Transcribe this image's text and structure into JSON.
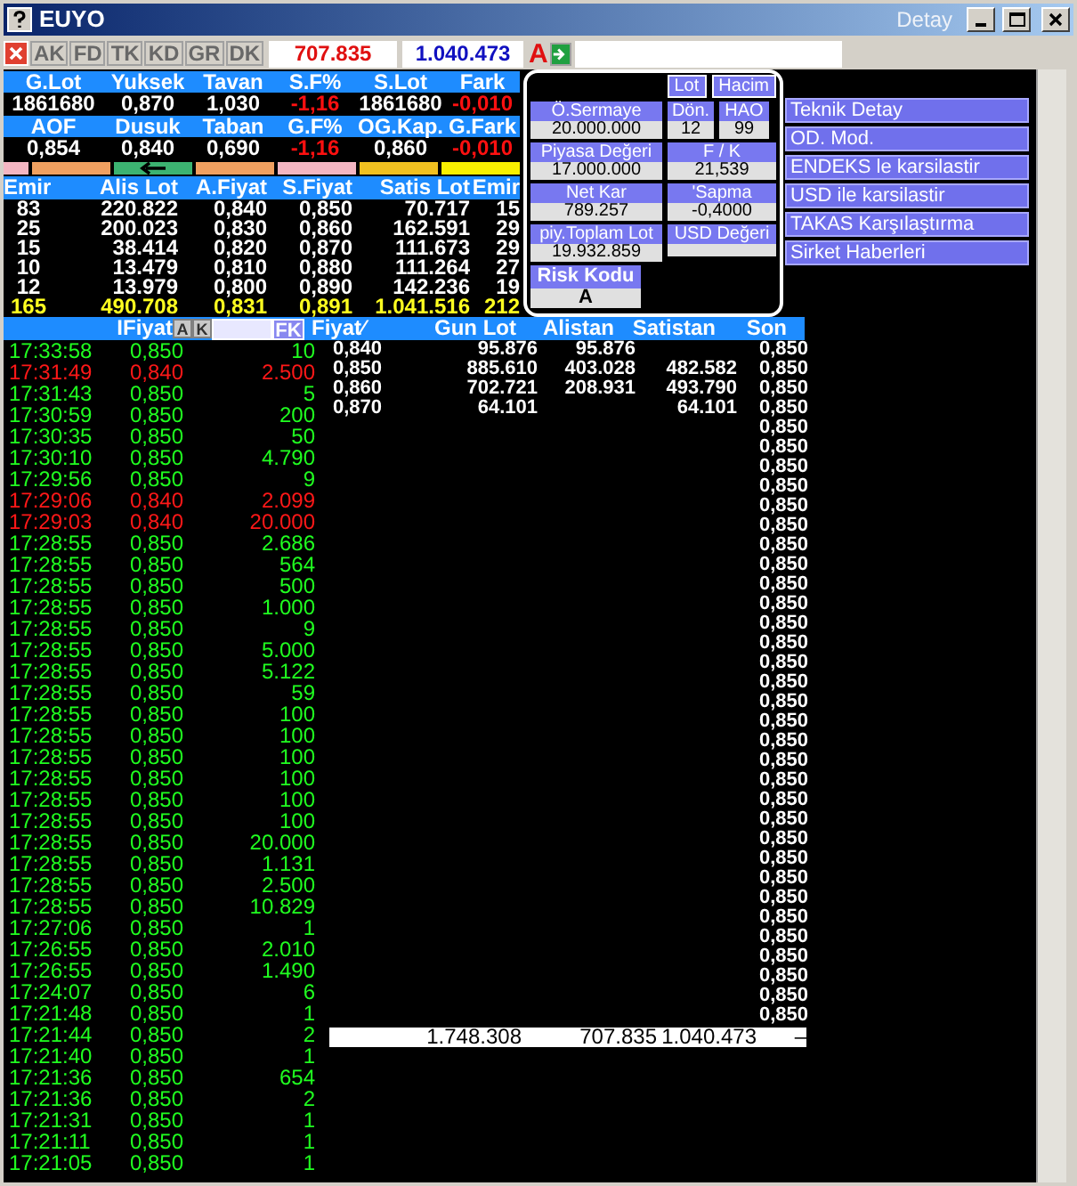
{
  "window": {
    "title": "EUYO",
    "detail_label": "Detay"
  },
  "toolbar": {
    "tabs": [
      "AK",
      "FD",
      "TK",
      "KD",
      "GR",
      "DK"
    ],
    "value_1": "707.835",
    "value_2": "1.040.473",
    "flag": "A"
  },
  "summary": [
    {
      "headers": [
        "G.Lot",
        "Yuksek",
        "Tavan",
        "S.F%",
        "S.Lot",
        "Fark"
      ],
      "values": [
        {
          "text": "1861680",
          "negative": false
        },
        {
          "text": "0,870",
          "negative": false
        },
        {
          "text": "1,030",
          "negative": false
        },
        {
          "text": "-1,16",
          "negative": true
        },
        {
          "text": "1861680",
          "negative": false
        },
        {
          "text": "-0,010",
          "negative": true
        }
      ]
    },
    {
      "headers": [
        "AOF",
        "Dusuk",
        "Taban",
        "G.F%",
        "OG.Kap.",
        "G.Fark"
      ],
      "values": [
        {
          "text": "0,854",
          "negative": false
        },
        {
          "text": "0,840",
          "negative": false
        },
        {
          "text": "0,690",
          "negative": false
        },
        {
          "text": "-1,16",
          "negative": true
        },
        {
          "text": "0,860",
          "negative": false
        },
        {
          "text": "-0,010",
          "negative": true
        }
      ]
    }
  ],
  "color_strip": [
    {
      "color": "#f4b6c2",
      "arrow": false
    },
    {
      "color": "#f0a060",
      "arrow": false
    },
    {
      "color": "#3cb371",
      "arrow": true
    },
    {
      "color": "#f0a060",
      "arrow": false
    },
    {
      "color": "#f4b6c2",
      "arrow": false
    },
    {
      "color": "#f0c020",
      "arrow": false
    },
    {
      "color": "#f8f000",
      "arrow": false
    }
  ],
  "order_book": {
    "columns": [
      "Emir",
      "Alis Lot",
      "A.Fiyat",
      "S.Fiyat",
      "Satis Lot",
      "Emir"
    ],
    "rows": [
      [
        "83",
        "220.822",
        "0,840",
        "0,850",
        "70.717",
        "15"
      ],
      [
        "25",
        "200.023",
        "0,830",
        "0,860",
        "162.591",
        "29"
      ],
      [
        "15",
        "38.414",
        "0,820",
        "0,870",
        "111.673",
        "29"
      ],
      [
        "10",
        "13.479",
        "0,810",
        "0,880",
        "111.264",
        "27"
      ],
      [
        "12",
        "13.979",
        "0,800",
        "0,890",
        "142.236",
        "19"
      ]
    ],
    "total": [
      "165",
      "490.708",
      "0,831",
      "0,891",
      "1.041.516",
      "212"
    ]
  },
  "info_panel": {
    "tabs": [
      "Lot",
      "Hacim"
    ],
    "field_rows": [
      [
        {
          "label": "Ö.Sermaye",
          "value": "20.000.000"
        },
        {
          "label": "Dön.",
          "value": "12"
        },
        {
          "label": "HAO",
          "value": "99"
        }
      ],
      [
        {
          "label": "Piyasa Değeri",
          "value": "17.000.000"
        },
        {
          "label": "F / K",
          "value": "21,539"
        }
      ],
      [
        {
          "label": "Net Kar",
          "value": "789.257"
        },
        {
          "label": "'Sapma",
          "value": "-0,4000"
        }
      ],
      [
        {
          "label": "piy.Toplam Lot",
          "value": "19.932.859"
        },
        {
          "label": "USD Değeri"
        }
      ]
    ],
    "risk": {
      "label": "Risk Kodu",
      "value": "A"
    }
  },
  "actions": [
    "Teknik Detay",
    "OD. Mod.",
    "ENDEKS le karsilastir",
    "USD ile karsilastir",
    "TAKAS Karşılaştırma",
    "Sirket Haberleri"
  ],
  "trades": {
    "column": "IFiyat",
    "filters": [
      "A",
      "K"
    ],
    "fk": "FK",
    "rows": [
      {
        "time": "17:33:58",
        "price": "0,850",
        "lot": "10",
        "falling": false
      },
      {
        "time": "17:31:49",
        "price": "0,840",
        "lot": "2.500",
        "falling": true
      },
      {
        "time": "17:31:43",
        "price": "0,850",
        "lot": "5",
        "falling": false
      },
      {
        "time": "17:30:59",
        "price": "0,850",
        "lot": "200",
        "falling": false
      },
      {
        "time": "17:30:35",
        "price": "0,850",
        "lot": "50",
        "falling": false
      },
      {
        "time": "17:30:10",
        "price": "0,850",
        "lot": "4.790",
        "falling": false
      },
      {
        "time": "17:29:56",
        "price": "0,850",
        "lot": "9",
        "falling": false
      },
      {
        "time": "17:29:06",
        "price": "0,840",
        "lot": "2.099",
        "falling": true
      },
      {
        "time": "17:29:03",
        "price": "0,840",
        "lot": "20.000",
        "falling": true
      },
      {
        "time": "17:28:55",
        "price": "0,850",
        "lot": "2.686",
        "falling": false
      },
      {
        "time": "17:28:55",
        "price": "0,850",
        "lot": "564",
        "falling": false
      },
      {
        "time": "17:28:55",
        "price": "0,850",
        "lot": "500",
        "falling": false
      },
      {
        "time": "17:28:55",
        "price": "0,850",
        "lot": "1.000",
        "falling": false
      },
      {
        "time": "17:28:55",
        "price": "0,850",
        "lot": "9",
        "falling": false
      },
      {
        "time": "17:28:55",
        "price": "0,850",
        "lot": "5.000",
        "falling": false
      },
      {
        "time": "17:28:55",
        "price": "0,850",
        "lot": "5.122",
        "falling": false
      },
      {
        "time": "17:28:55",
        "price": "0,850",
        "lot": "59",
        "falling": false
      },
      {
        "time": "17:28:55",
        "price": "0,850",
        "lot": "100",
        "falling": false
      },
      {
        "time": "17:28:55",
        "price": "0,850",
        "lot": "100",
        "falling": false
      },
      {
        "time": "17:28:55",
        "price": "0,850",
        "lot": "100",
        "falling": false
      },
      {
        "time": "17:28:55",
        "price": "0,850",
        "lot": "100",
        "falling": false
      },
      {
        "time": "17:28:55",
        "price": "0,850",
        "lot": "100",
        "falling": false
      },
      {
        "time": "17:28:55",
        "price": "0,850",
        "lot": "100",
        "falling": false
      },
      {
        "time": "17:28:55",
        "price": "0,850",
        "lot": "20.000",
        "falling": false
      },
      {
        "time": "17:28:55",
        "price": "0,850",
        "lot": "1.131",
        "falling": false
      },
      {
        "time": "17:28:55",
        "price": "0,850",
        "lot": "2.500",
        "falling": false
      },
      {
        "time": "17:28:55",
        "price": "0,850",
        "lot": "10.829",
        "falling": false
      },
      {
        "time": "17:27:06",
        "price": "0,850",
        "lot": "1",
        "falling": false
      },
      {
        "time": "17:26:55",
        "price": "0,850",
        "lot": "2.010",
        "falling": false
      },
      {
        "time": "17:26:55",
        "price": "0,850",
        "lot": "1.490",
        "falling": false
      },
      {
        "time": "17:24:07",
        "price": "0,850",
        "lot": "6",
        "falling": false
      },
      {
        "time": "17:21:48",
        "price": "0,850",
        "lot": "1",
        "falling": false
      },
      {
        "time": "17:21:44",
        "price": "0,850",
        "lot": "2",
        "falling": false
      },
      {
        "time": "17:21:40",
        "price": "0,850",
        "lot": "1",
        "falling": false
      },
      {
        "time": "17:21:36",
        "price": "0,850",
        "lot": "654",
        "falling": false
      },
      {
        "time": "17:21:36",
        "price": "0,850",
        "lot": "2",
        "falling": false
      },
      {
        "time": "17:21:31",
        "price": "0,850",
        "lot": "1",
        "falling": false
      },
      {
        "time": "17:21:11",
        "price": "0,850",
        "lot": "1",
        "falling": false
      },
      {
        "time": "17:21:05",
        "price": "0,850",
        "lot": "1",
        "falling": false
      }
    ]
  },
  "price_table": {
    "columns": [
      "Fiyat∕",
      "Gun Lot",
      "Alistan",
      "Satistan",
      "Son"
    ],
    "rows": [
      [
        "0,840",
        "95.876",
        "95.876",
        ""
      ],
      [
        "0,850",
        "885.610",
        "403.028",
        "482.582"
      ],
      [
        "0,860",
        "702.721",
        "208.931",
        "493.790"
      ],
      [
        "0,870",
        "64.101",
        "",
        "64.101"
      ]
    ],
    "son": [
      "0,850",
      "0,850",
      "0,850",
      "0,850",
      "0,850",
      "0,850",
      "0,850",
      "0,850",
      "0,850",
      "0,850",
      "0,850",
      "0,850",
      "0,850",
      "0,850",
      "0,850",
      "0,850",
      "0,850",
      "0,850",
      "0,850",
      "0,850",
      "0,850",
      "0,850",
      "0,850",
      "0,850",
      "0,850",
      "0,850",
      "0,850",
      "0,850",
      "0,850",
      "0,850",
      "0,850",
      "0,850",
      "0,850",
      "0,850",
      "0,850"
    ],
    "totals": [
      "1.748.308",
      "707.835",
      "1.040.473",
      "–"
    ]
  }
}
